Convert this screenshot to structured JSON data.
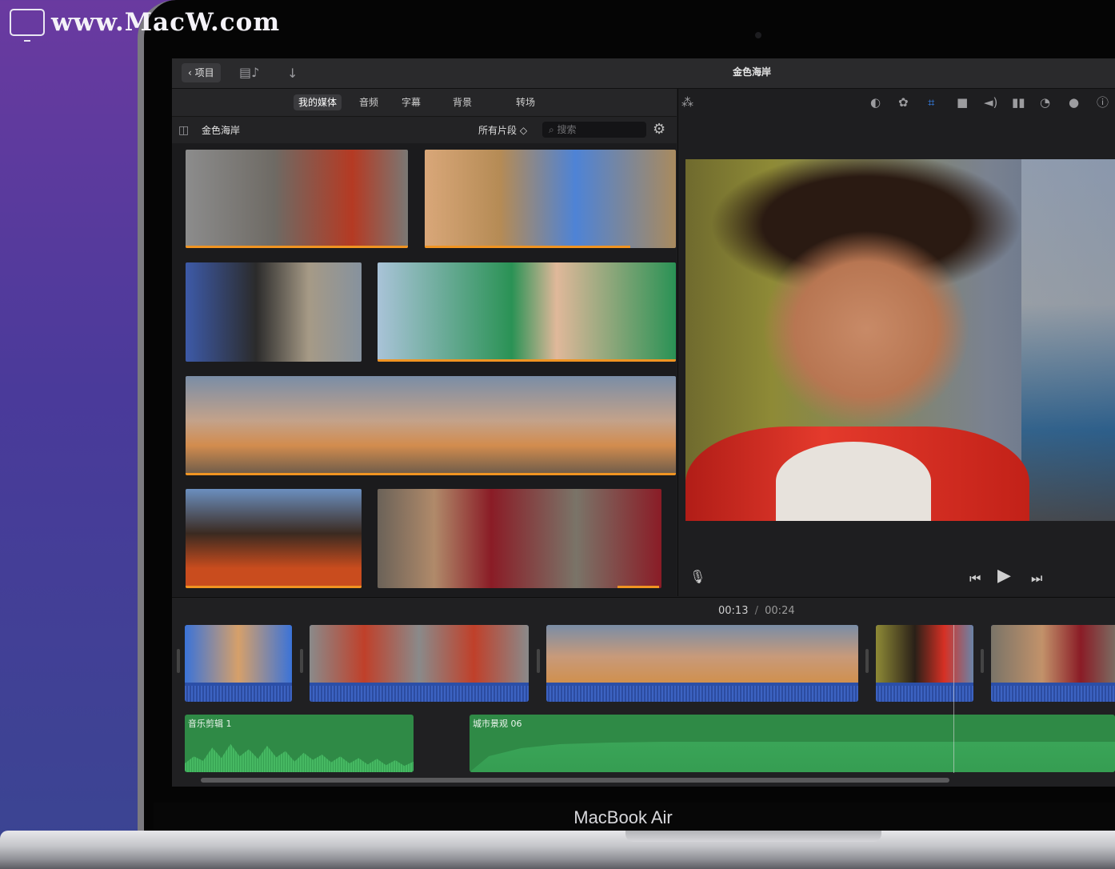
{
  "watermark": {
    "text": "www.MacW.com"
  },
  "device": {
    "label": "MacBook Air"
  },
  "app": {
    "window_title": "金色海岸",
    "back_label": "项目",
    "tabs": [
      {
        "label": "我的媒体",
        "active": true
      },
      {
        "label": "音频",
        "active": false
      },
      {
        "label": "字幕",
        "active": false
      },
      {
        "label": "背景",
        "active": false
      },
      {
        "label": "转场",
        "active": false
      }
    ],
    "library": {
      "title": "金色海岸",
      "filter": "所有片段 ◇",
      "search_placeholder": "搜索"
    },
    "viewer_tools": [
      "magic-wand-icon",
      "color-balance-icon",
      "color-correction-icon",
      "crop-icon",
      "stabilization-icon",
      "volume-icon",
      "noise-eq-icon",
      "speed-icon",
      "clip-filter-icon",
      "info-icon"
    ],
    "timeline": {
      "current_time": "00:13",
      "separator": "/",
      "duration": "00:24",
      "audio_clips": [
        "音乐剪辑 1",
        "城市景观 06"
      ]
    }
  },
  "colors": {
    "accent": "#3a8cff",
    "clip_bar": "#f09422",
    "audio": "#2f8a46",
    "video_audio": "#2b4fa8"
  }
}
